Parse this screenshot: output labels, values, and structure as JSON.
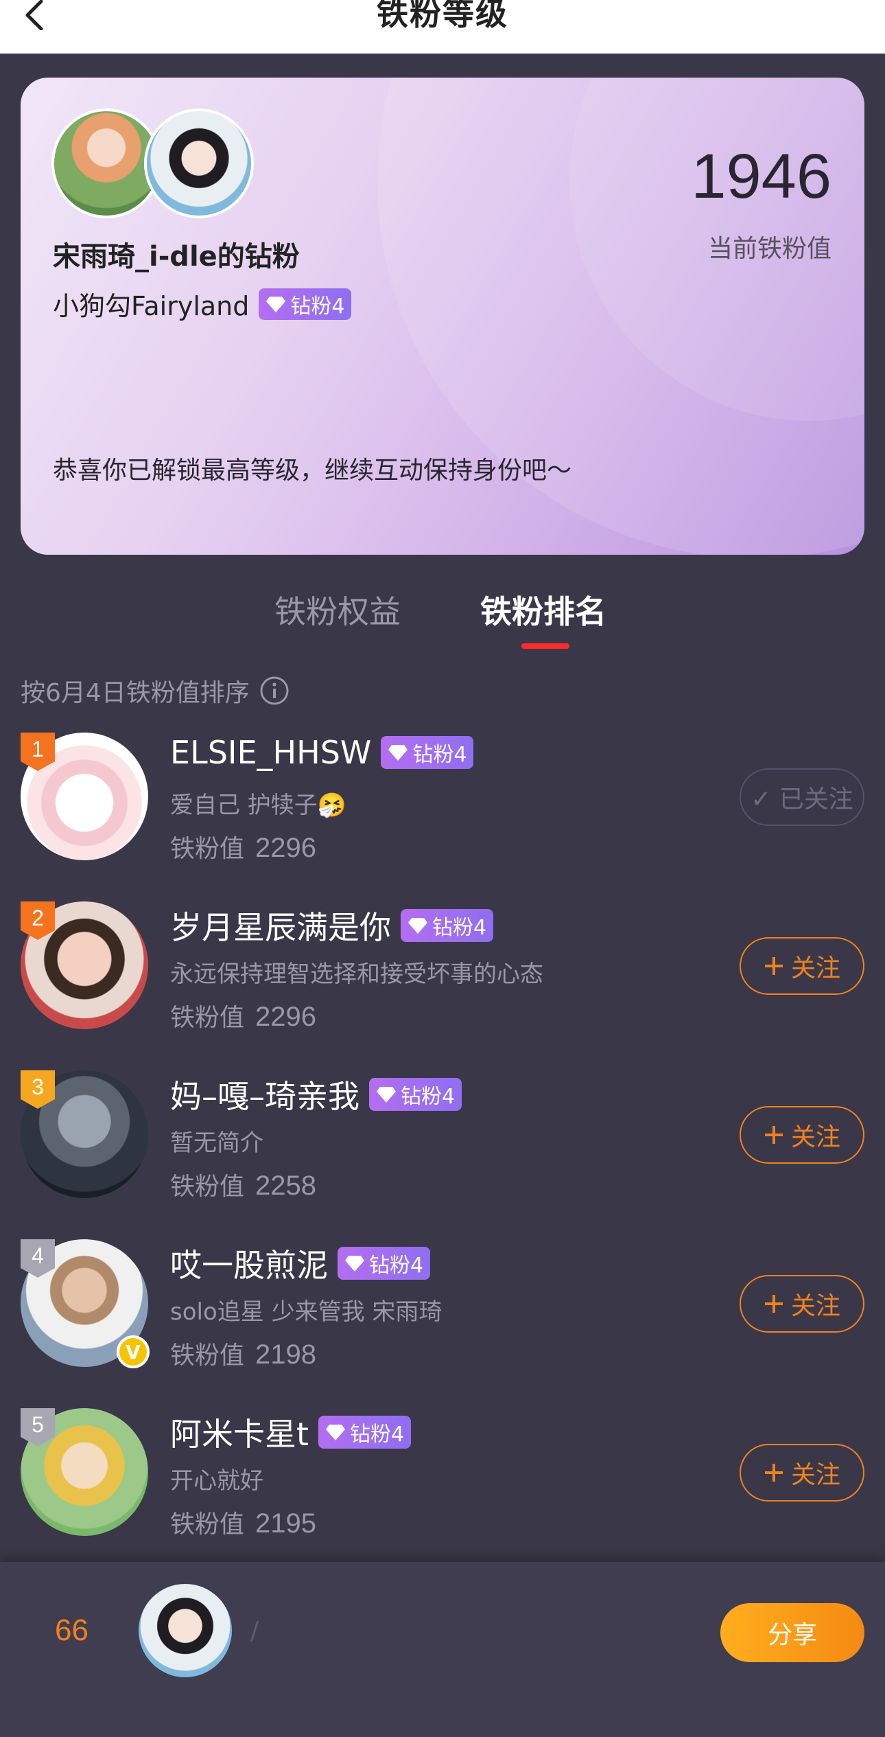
{
  "header": {
    "title": "铁粉等级"
  },
  "card": {
    "fan_title": "宋雨琦_i-dle的钻粉",
    "user_name": "小狗勾Fairyland",
    "badge": "钻粉4",
    "score": "1946",
    "score_label": "当前铁粉值",
    "congrats": "恭喜你已解锁最高等级，继续互动保持身份吧～"
  },
  "tabs": [
    {
      "label": "铁粉权益",
      "active": false
    },
    {
      "label": "铁粉排名",
      "active": true
    }
  ],
  "sort_label": "按6月4日铁粉值排序",
  "value_label": "铁粉值",
  "ranking": [
    {
      "rank": "1",
      "name": "ELSIE_HHSW",
      "badge": "钻粉4",
      "bio": "爱自己 护犊子🤧",
      "value": "2296",
      "button": "✓ 已关注",
      "followed": true,
      "rank_color": "#f5731f",
      "verified": false
    },
    {
      "rank": "2",
      "name": "岁月星辰满是你",
      "badge": "钻粉4",
      "bio": "永远保持理智选择和接受坏事的心态",
      "value": "2296",
      "button": "关注",
      "followed": false,
      "rank_color": "#f5731f",
      "verified": false
    },
    {
      "rank": "3",
      "name": "妈–嘎–琦亲我",
      "badge": "钻粉4",
      "bio": "暂无简介",
      "value": "2258",
      "button": "关注",
      "followed": false,
      "rank_color": "#f5a81f",
      "verified": false
    },
    {
      "rank": "4",
      "name": "哎一股煎泥",
      "badge": "钻粉4",
      "bio": "solo追星 少来管我 宋雨琦",
      "value": "2198",
      "button": "关注",
      "followed": false,
      "rank_color": "#a9a6b3",
      "verified": true
    },
    {
      "rank": "5",
      "name": "阿米卡星t",
      "badge": "钻粉4",
      "bio": "开心就好",
      "value": "2195",
      "button": "关注",
      "followed": false,
      "rank_color": "#a9a6b3",
      "verified": false
    }
  ],
  "bottom": {
    "my_rank": "66",
    "my_name": "/",
    "share": "分享"
  },
  "colors": {
    "accent": "#f0821e",
    "background": "#3a3749",
    "badge": "#b46ef0"
  }
}
